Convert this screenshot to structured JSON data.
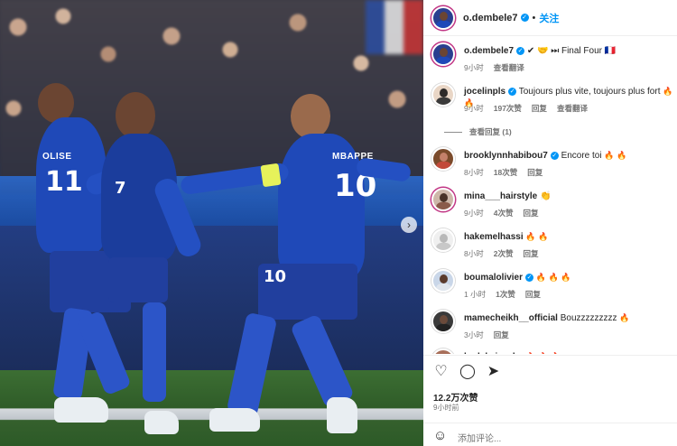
{
  "post_owner": {
    "username": "o.dembele7",
    "follow_label": "关注",
    "separator": "•"
  },
  "caption": {
    "username": "o.dembele7",
    "text": "✔ 🤝 ⏭ Final Four 🇫🇷",
    "time": "9小时",
    "translate": "查看翻译"
  },
  "comments": [
    {
      "username": "jocelinpls",
      "verified": true,
      "text": "Toujours plus vite, toujours plus fort",
      "emoji": "🔥 🔥",
      "time": "9小时",
      "likes": "197次赞",
      "reply": "回复",
      "translate": "查看翻译",
      "view_replies": "查看回复 (1)"
    },
    {
      "username": "brooklynnhabibou7",
      "verified": true,
      "text": "Encore toi",
      "emoji": "🔥 🔥",
      "time": "8小时",
      "likes": "18次赞",
      "reply": "回复"
    },
    {
      "username": "mina___hairstyle",
      "verified": false,
      "text": "",
      "emoji": "👏",
      "time": "9小时",
      "likes": "4次赞",
      "reply": "回复"
    },
    {
      "username": "hakemelhassi",
      "verified": false,
      "text": "",
      "emoji": "🔥 🔥",
      "time": "8小时",
      "likes": "2次赞",
      "reply": "回复"
    },
    {
      "username": "boumalolivier",
      "verified": true,
      "text": "",
      "emoji": "🔥 🔥 🔥",
      "time": "1 小时",
      "likes": "1次赞",
      "reply": "回复"
    },
    {
      "username": "mamecheikh__official",
      "verified": false,
      "text": "Bouzzzzzzzzz",
      "emoji": "🔥",
      "time": "3小时",
      "likes": "",
      "reply": "回复"
    },
    {
      "username": "badakaissake",
      "verified": false,
      "text": "",
      "emoji": "🔥 🔥 🔥",
      "time": "",
      "likes": "",
      "reply": ""
    }
  ],
  "actions": {
    "like_icon": "heart-icon",
    "comment_icon": "comment-icon",
    "share_icon": "send-icon",
    "likes": "12.2万次赞",
    "time_ago": "9小时前"
  },
  "add_comment": {
    "emoji_icon": "smiley-icon",
    "placeholder": "添加评论..."
  },
  "photo": {
    "jersey_name_left": "OLISE",
    "jersey_name_right": "MBAPPE",
    "number_left": "11",
    "number_mid": "7",
    "number_right": "10",
    "number_shorts": "10"
  },
  "colors": {
    "accent": "#0095f6",
    "jersey": "#1f49b8",
    "story_ring": "#c13584"
  }
}
